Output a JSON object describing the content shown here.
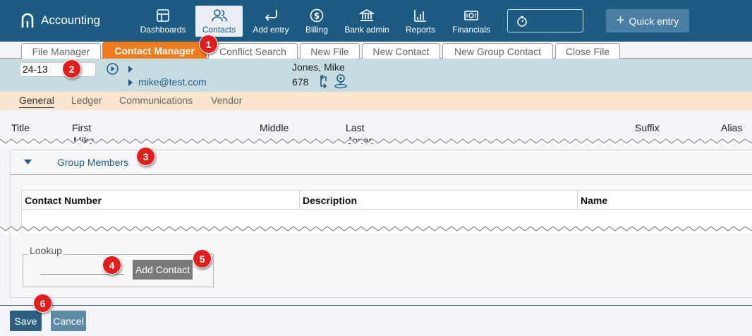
{
  "app": {
    "title": "Accounting"
  },
  "nav": {
    "items": [
      {
        "label": "Dashboards",
        "icon": "dashboard-icon"
      },
      {
        "label": "Contacts",
        "icon": "contacts-icon"
      },
      {
        "label": "Add entry",
        "icon": "return-arrow-icon"
      },
      {
        "label": "Billing",
        "icon": "dollar-icon"
      },
      {
        "label": "Bank admin",
        "icon": "bank-icon"
      },
      {
        "label": "Reports",
        "icon": "bar-chart-icon"
      },
      {
        "label": "Financials",
        "icon": "money-icon"
      }
    ],
    "timer_icon": "stopwatch-icon",
    "quick_entry": "Quick entry"
  },
  "tabs": [
    {
      "label": "File Manager"
    },
    {
      "label": "Contact Manager"
    },
    {
      "label": "Conflict Search"
    },
    {
      "label": "New File"
    },
    {
      "label": "New Contact"
    },
    {
      "label": "New Group Contact"
    },
    {
      "label": "Close File"
    }
  ],
  "contact": {
    "file_number": "24-13",
    "email": "mike@test.com",
    "name": "Jones, Mike",
    "number": "678"
  },
  "subtabs": [
    {
      "label": "General"
    },
    {
      "label": "Ledger"
    },
    {
      "label": "Communications"
    },
    {
      "label": "Vendor"
    }
  ],
  "fields": {
    "title_label": "Title",
    "first_label": "First",
    "first_value": "Mike",
    "middle_label": "Middle",
    "last_label": "Last",
    "last_value": "Jones",
    "suffix_label": "Suffix",
    "alias_label": "Alias"
  },
  "group_members": {
    "label": "Group Members",
    "columns": [
      "Contact Number",
      "Description",
      "Name"
    ]
  },
  "lookup": {
    "legend": "Lookup",
    "button": "Add Contact"
  },
  "footer": {
    "save": "Save",
    "cancel": "Cancel"
  },
  "callouts": [
    "1",
    "2",
    "3",
    "4",
    "5",
    "6"
  ],
  "colors": {
    "nav_bg": "#1d5b82",
    "active_tab": "#f07c1e",
    "band": "#c6dce0",
    "subtab_bg": "#fbe4cd",
    "callout": "#e01e1e"
  }
}
